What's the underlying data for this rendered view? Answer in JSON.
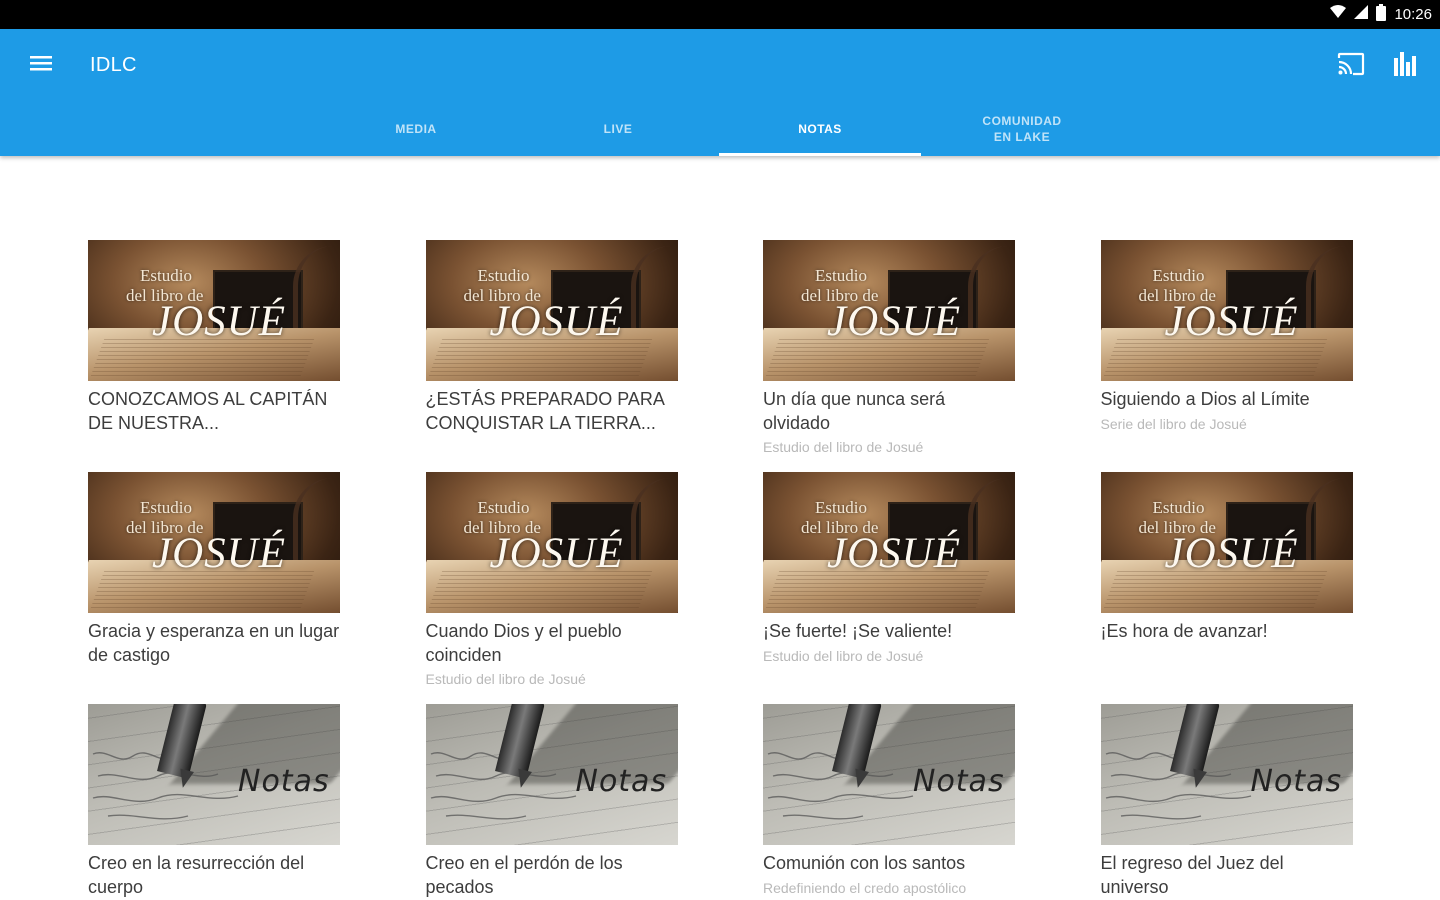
{
  "status_bar": {
    "time": "10:26",
    "icons": [
      "wifi-icon",
      "signal-icon",
      "battery-icon"
    ]
  },
  "app_bar": {
    "title": "IDLC",
    "icons": [
      "menu-icon",
      "cast-icon",
      "equalizer-icon"
    ],
    "color": "#1e9be6",
    "tabs": [
      {
        "label": "MEDIA",
        "active": false
      },
      {
        "label": "LIVE",
        "active": false
      },
      {
        "label": "NOTAS",
        "active": true
      },
      {
        "label": "COMUNIDAD\nEN LAKE",
        "active": false
      }
    ]
  },
  "thumb_text": {
    "josue_line1": "Estudio",
    "josue_line2": "del libro de",
    "josue_line3": "JOSUÉ",
    "notas": "Notas"
  },
  "cards": [
    {
      "thumb": "josue",
      "title": "CONOZCAMOS AL CAPITÁN DE NUESTRA...",
      "subtitle": ""
    },
    {
      "thumb": "josue",
      "title": "¿ESTÁS PREPARADO PARA CONQUISTAR LA TIERRA...",
      "subtitle": ""
    },
    {
      "thumb": "josue",
      "title": "Un día que nunca será olvidado",
      "subtitle": "Estudio del libro de Josué"
    },
    {
      "thumb": "josue",
      "title": "Siguiendo a Dios al Límite",
      "subtitle": "Serie del libro de Josué"
    },
    {
      "thumb": "josue",
      "title": "Gracia y esperanza en un lugar de castigo",
      "subtitle": ""
    },
    {
      "thumb": "josue",
      "title": "Cuando Dios  y el pueblo coinciden",
      "subtitle": "Estudio del libro de Josué"
    },
    {
      "thumb": "josue",
      "title": "¡Se fuerte! ¡Se valiente!",
      "subtitle": "Estudio del libro de Josué"
    },
    {
      "thumb": "josue",
      "title": "¡Es hora de avanzar!",
      "subtitle": ""
    },
    {
      "thumb": "notas",
      "title": "Creo en la resurrección del cuerpo",
      "subtitle": ""
    },
    {
      "thumb": "notas",
      "title": "Creo en el perdón de los pecados",
      "subtitle": ""
    },
    {
      "thumb": "notas",
      "title": "Comunión con los santos",
      "subtitle": "Redefiniendo el credo apostólico"
    },
    {
      "thumb": "notas",
      "title": "El regreso  del Juez del universo",
      "subtitle": ""
    }
  ]
}
